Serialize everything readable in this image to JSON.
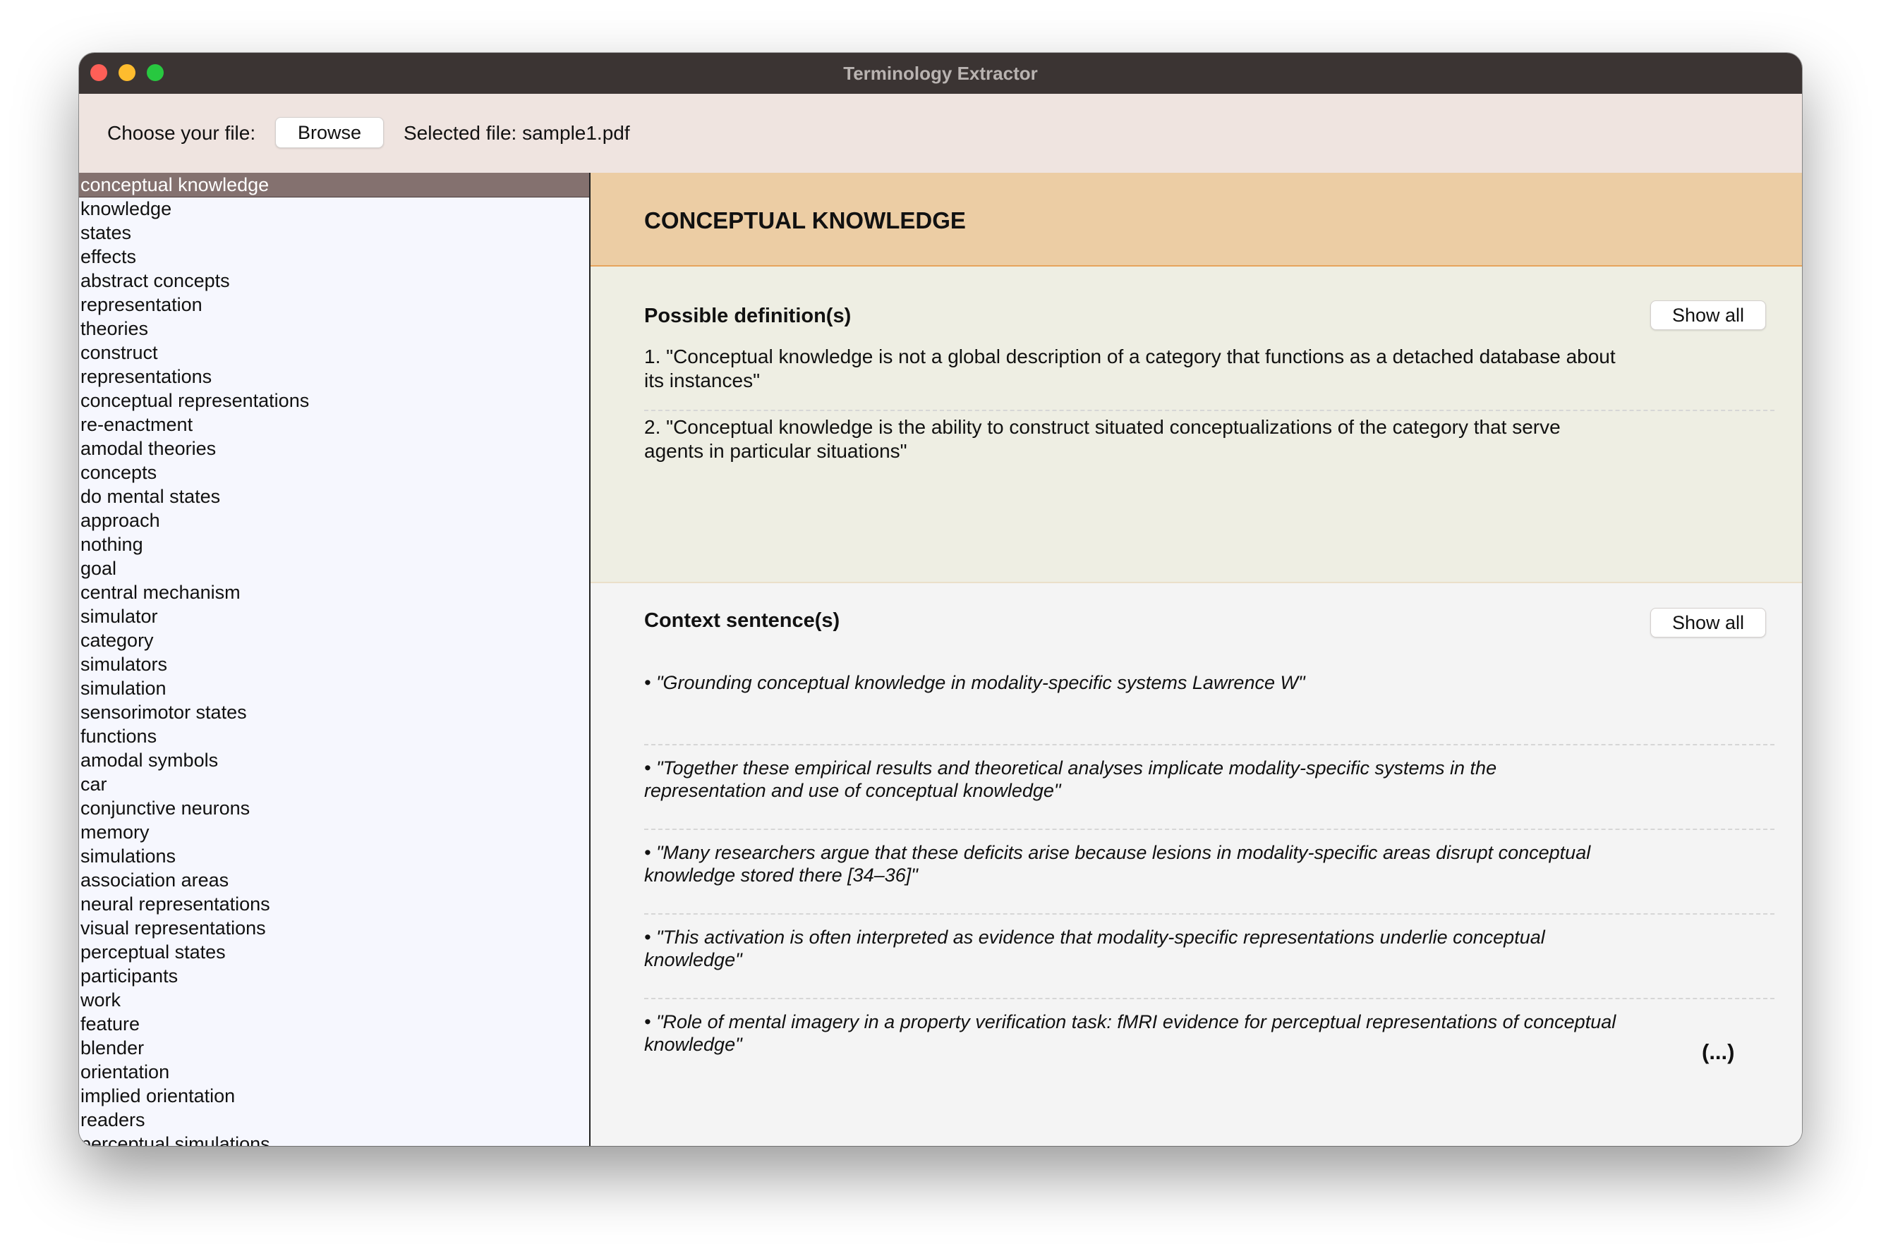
{
  "window": {
    "title": "Terminology Extractor"
  },
  "toolbar": {
    "choose_label": "Choose your file:",
    "browse_label": "Browse",
    "selected_file_label": "Selected file: sample1.pdf"
  },
  "terms": [
    "conceptual knowledge",
    "knowledge",
    "states",
    "effects",
    "abstract concepts",
    "representation",
    "theories",
    "construct",
    "representations",
    "conceptual representations",
    "re-enactment",
    "amodal theories",
    "concepts",
    "do mental states",
    "approach",
    "nothing",
    "goal",
    "central mechanism",
    "simulator",
    "category",
    "simulators",
    "simulation",
    "sensorimotor states",
    "functions",
    "amodal symbols",
    "car",
    "conjunctive neurons",
    "memory",
    "simulations",
    "association areas",
    "neural representations",
    "visual representations",
    "perceptual states",
    "participants",
    "work",
    "feature",
    "blender",
    "orientation",
    "implied orientation",
    "readers",
    "perceptual simulations"
  ],
  "selected_index": 0,
  "detail": {
    "title": "CONCEPTUAL KNOWLEDGE",
    "definitions_heading": "Possible definition(s)",
    "definitions_show_all": "Show all",
    "definitions": [
      "1. \"Conceptual knowledge is not a global description of a category that functions as a detached database about its instances\"",
      "2. \"Conceptual knowledge is the ability to construct situated conceptualizations of the category that serve agents in particular situations\""
    ],
    "context_heading": "Context sentence(s)",
    "context_show_all": "Show all",
    "contexts": [
      "• \"Grounding conceptual knowledge in modality-specific systems Lawrence W\"",
      "• \"Together these empirical results and theoretical analyses implicate modality-specific systems in the representation and use of conceptual knowledge\"",
      "• \"Many researchers argue that these deficits arise because lesions in modality-specific areas disrupt conceptual knowledge stored there [34–36]\"",
      "• \"This activation is often interpreted as evidence that modality-specific representations underlie conceptual knowledge\"",
      "• \"Role of mental imagery in a property verification task: fMRI evidence for perceptual representations of conceptual knowledge\""
    ],
    "more_label": "(...)"
  },
  "colors": {
    "titlebar": "#3b3433",
    "toolbar": "#efe4e0",
    "sidebar": "#f6f7fe",
    "selected_term": "#84716f",
    "header": "#eccda4",
    "definitions_bg": "#eeeee3",
    "context_bg": "#f4f4f4"
  }
}
